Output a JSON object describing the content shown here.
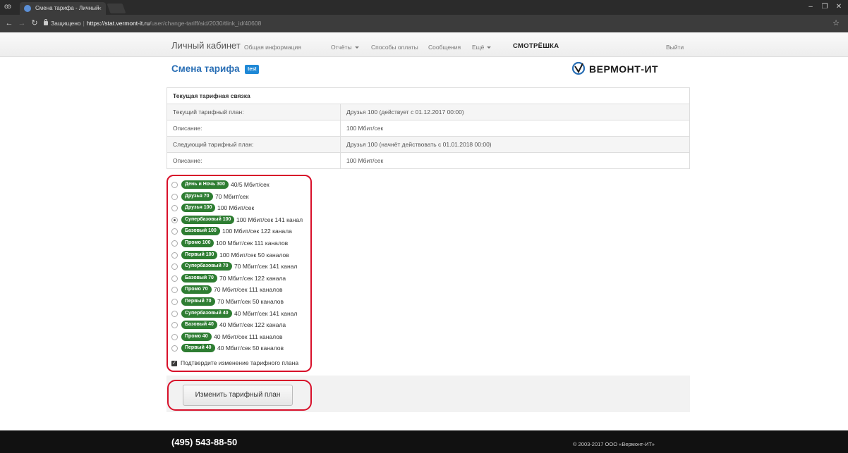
{
  "browser": {
    "tab_title": "Смена тарифа - Личный",
    "tab_close": "×",
    "secure_label": "Защищено",
    "url_scheme_host": "https://stat.vermont-it.ru",
    "url_path": "/user/change-tariff/aid/2030/tlink_id/40608"
  },
  "nav": {
    "brand": "Личный кабинет",
    "links": [
      "Общая информация",
      "Отчёты",
      "Способы оплаты",
      "Сообщения",
      "Ещё"
    ],
    "smotreshka": "СМОТРЁШКА",
    "logout": "Выйти"
  },
  "page": {
    "title": "Смена тарифа",
    "badge": "test",
    "logo_text": "ВЕРМОНТ-ИТ"
  },
  "current": {
    "heading": "Текущая тарифная связка",
    "rows": [
      {
        "label": "Текущий тарифный план:",
        "value": "Друзья 100 (действует с 01.12.2017 00:00)"
      },
      {
        "label": "Описание:",
        "value": "100 Мбит/сек"
      },
      {
        "label": "Следующий тарифный план:",
        "value": "Друзья 100 (начнёт действовать с 01.01.2018 00:00)"
      },
      {
        "label": "Описание:",
        "value": "100 Мбит/сек"
      }
    ]
  },
  "tariffs": [
    {
      "name": "День и Ночь 300",
      "desc": "40/5 Мбит/сек",
      "selected": false
    },
    {
      "name": "Друзья 70",
      "desc": "70 Мбит/сек",
      "selected": false
    },
    {
      "name": "Друзья 100",
      "desc": "100 Мбит/сек",
      "selected": false
    },
    {
      "name": "Супербазовый 100",
      "desc": "100 Мбит/сек 141 канал",
      "selected": true
    },
    {
      "name": "Базовый 100",
      "desc": "100 Мбит/сек 122 канала",
      "selected": false
    },
    {
      "name": "Промо 100",
      "desc": "100 Мбит/сек 111 каналов",
      "selected": false
    },
    {
      "name": "Первый 100",
      "desc": "100 Мбит/сек 50 каналов",
      "selected": false
    },
    {
      "name": "Супербазовый 70",
      "desc": "70 Мбит/сек 141 канал",
      "selected": false
    },
    {
      "name": "Базовый 70",
      "desc": "70 Мбит/сек 122 канала",
      "selected": false
    },
    {
      "name": "Промо 70",
      "desc": "70 Мбит/сек 111 каналов",
      "selected": false
    },
    {
      "name": "Первый 70",
      "desc": "70 Мбит/сек 50 каналов",
      "selected": false
    },
    {
      "name": "Супербазовый 40",
      "desc": "40 Мбит/сек 141 канал",
      "selected": false
    },
    {
      "name": "Базовый 40",
      "desc": "40 Мбит/сек 122 канала",
      "selected": false
    },
    {
      "name": "Промо 40",
      "desc": "40 Мбит/сек 111 каналов",
      "selected": false
    },
    {
      "name": "Первый 40",
      "desc": "40 Мбит/сек 50 каналов",
      "selected": false
    }
  ],
  "confirm_label": "Подтвердите изменение тарифного плана",
  "submit_label": "Изменить тарифный план",
  "footer": {
    "phone": "(495) 543-88-50",
    "copyright": "© 2003-2017 ООО «Вермонт-ИТ»"
  },
  "colors": {
    "label_green": "#2e7d32",
    "title_blue": "#2a6fb5",
    "highlight_red": "#d8102a"
  }
}
